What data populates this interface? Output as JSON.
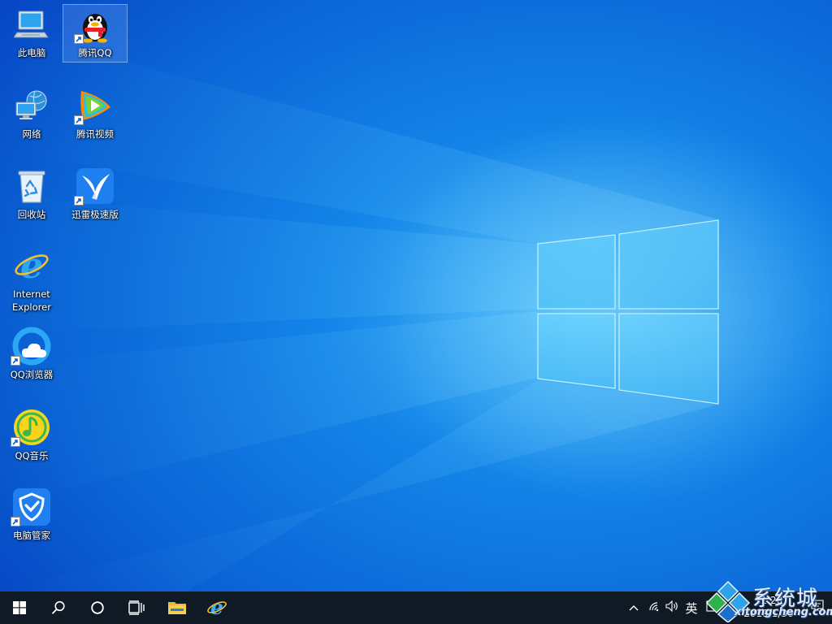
{
  "desktop": {
    "icons": [
      {
        "label": "此电脑",
        "icon": "this-pc-icon"
      },
      {
        "label": "腾讯QQ",
        "icon": "qq-penguin-icon",
        "shortcut": true,
        "selected": true
      },
      {
        "label": "网络",
        "icon": "network-icon"
      },
      {
        "label": "腾讯视频",
        "icon": "tencent-video-icon",
        "shortcut": true
      },
      {
        "label": "回收站",
        "icon": "recycle-bin-icon"
      },
      {
        "label": "迅雷极速版",
        "icon": "xunlei-icon",
        "shortcut": true
      },
      {
        "label": "Internet Explorer",
        "icon": "internet-explorer-icon"
      },
      {
        "label": "QQ浏览器",
        "icon": "qq-browser-icon",
        "shortcut": true
      },
      {
        "label": "QQ音乐",
        "icon": "qq-music-icon",
        "shortcut": true
      },
      {
        "label": "电脑管家",
        "icon": "pc-manager-icon",
        "shortcut": true
      }
    ]
  },
  "taskbar": {
    "buttons": [
      "windows-start-icon",
      "search-icon",
      "cortana-icon",
      "task-view-icon",
      "file-explorer-icon",
      "internet-explorer-icon"
    ],
    "tray": {
      "overflow_icon": "chevron-up-icon",
      "network_icon": "wifi-icon",
      "volume_icon": "speaker-icon",
      "ime_label": "英",
      "ime_mode_icon": "ime-mode-icon",
      "time": "11:20",
      "date": "2019/1/30",
      "notification_icon": "action-center-icon"
    }
  },
  "watermark": {
    "text": "系统城",
    "url": "xitongcheng.com"
  },
  "colors": {
    "wallpaper_dark": "#0746c4",
    "wallpaper_mid": "#0f7ee6",
    "wallpaper_light": "#69d3ff",
    "taskbar": "#101a25"
  }
}
